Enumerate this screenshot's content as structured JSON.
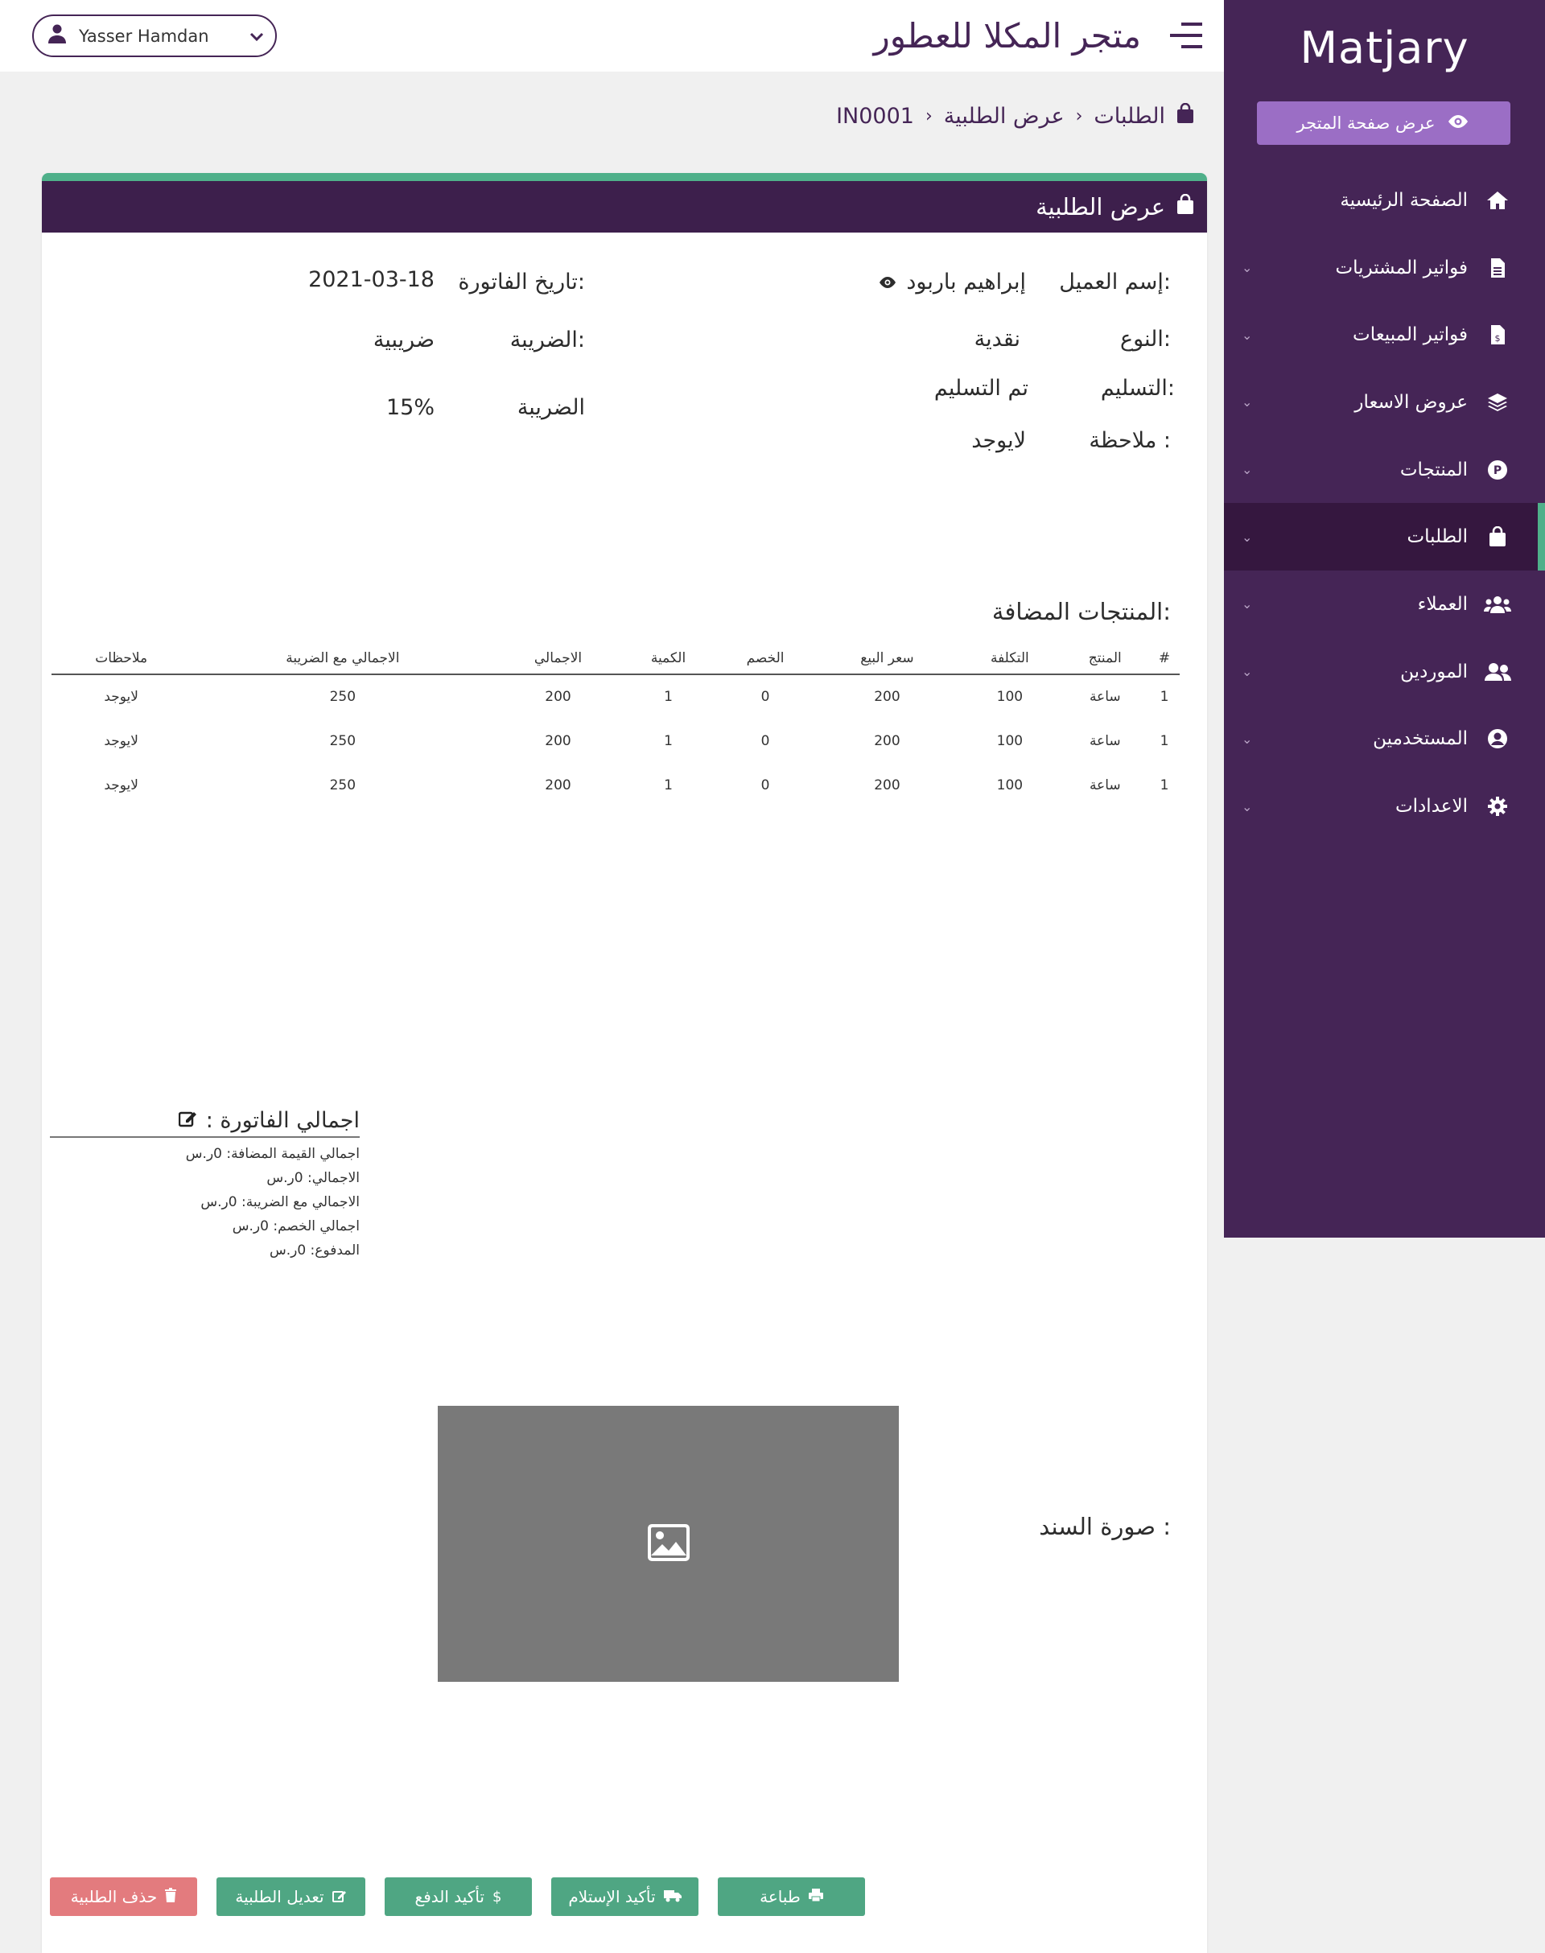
{
  "sidebar": {
    "brand": "Matjary",
    "store_button": "عرض صفحة المتجر",
    "items": [
      {
        "label": "الصفحة الرئيسية",
        "icon": "home-icon",
        "has_chevron": false
      },
      {
        "label": "فواتير المشتريات",
        "icon": "file-icon",
        "has_chevron": true
      },
      {
        "label": "فواتير المبيعات",
        "icon": "file-dollar-icon",
        "has_chevron": true
      },
      {
        "label": "عروض الاسعار",
        "icon": "layers-icon",
        "has_chevron": true
      },
      {
        "label": "المنتجات",
        "icon": "product-icon",
        "has_chevron": true
      },
      {
        "label": "الطلبات",
        "icon": "shopping-bag-icon",
        "has_chevron": true,
        "active": true
      },
      {
        "label": "العملاء",
        "icon": "users-icon",
        "has_chevron": true
      },
      {
        "label": "الموردين",
        "icon": "user-friends-icon",
        "has_chevron": true
      },
      {
        "label": "المستخدمين",
        "icon": "user-circle-icon",
        "has_chevron": true
      },
      {
        "label": "الاعدادات",
        "icon": "gear-icon",
        "has_chevron": true
      }
    ]
  },
  "topbar": {
    "user_name": "Yasser Hamdan",
    "shop_title": "متجر المكلا للعطور"
  },
  "breadcrumb": {
    "root": "الطلبات",
    "middle": "عرض الطلبية",
    "current": "IN0001"
  },
  "card": {
    "title": "عرض الطلبية",
    "customer_label": "إسم العميل:",
    "customer_value": "إبراهيم باربود",
    "type_label": "النوع:",
    "type_value": "نقدية",
    "delivery_label": "التسليم:",
    "delivery_value": "تم التسليم",
    "note_label": "ملاحظة :",
    "note_value": "لايوجد",
    "date_label": "تاريخ الفاتورة:",
    "date_value": "2021-03-18",
    "tax_label": "الضريبة:",
    "tax_value": "ضريبية",
    "tax_rate_label": "الضريبة",
    "tax_rate_value": "15%"
  },
  "products": {
    "title": "المنتجات المضافة:",
    "headers": [
      "#",
      "المنتج",
      "التكلفة",
      "سعر البيع",
      "الخصم",
      "الكمية",
      "الاجمالي",
      "الاجمالي مع الضريبة",
      "ملاحظات"
    ],
    "rows": [
      [
        "1",
        "ساعة",
        "100",
        "200",
        "0",
        "1",
        "200",
        "250",
        "لايوجد"
      ],
      [
        "1",
        "ساعة",
        "100",
        "200",
        "0",
        "1",
        "200",
        "250",
        "لايوجد"
      ],
      [
        "1",
        "ساعة",
        "100",
        "200",
        "0",
        "1",
        "200",
        "250",
        "لايوجد"
      ]
    ]
  },
  "totals": {
    "title": "اجمالي الفاتورة :",
    "rows": [
      "اجمالي القيمة المضافة: 0ر.س",
      "الاجمالي: 0ر.س",
      "الاجمالي مع الضريبة: 0ر.س",
      "اجمالي الخصم: 0ر.س",
      "المدفوع: 0ر.س"
    ]
  },
  "receipt": {
    "label": "صورة السند :"
  },
  "actions": {
    "print": "طباعة",
    "confirm_receipt": "تأكيد الإستلام",
    "confirm_payment": "تأكيد الدفع",
    "edit": "تعديل الطلبية",
    "delete": "حذف الطلبية"
  },
  "colors": {
    "sidebar": "#452556",
    "header": "#3d1f4c",
    "accent_green": "#4fb08a",
    "danger": "#e37b7e",
    "store_button": "#9b6ec5"
  }
}
